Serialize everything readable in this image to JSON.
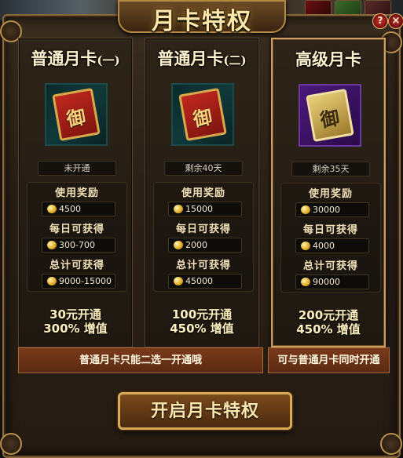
{
  "window": {
    "title": "月卡特权",
    "help_label": "?",
    "close_label": "×"
  },
  "cards": [
    {
      "title": "普通月卡",
      "title_suffix": "(一)",
      "status": "未开通",
      "use_reward_label": "使用奖励",
      "use_reward": "4500",
      "daily_label": "每日可获得",
      "daily": "300-700",
      "total_label": "总计可获得",
      "total": "9000-15000",
      "price": "30元开通",
      "bonus": "300% 增值"
    },
    {
      "title": "普通月卡",
      "title_suffix": "(二)",
      "status": "剩余40天",
      "use_reward_label": "使用奖励",
      "use_reward": "15000",
      "daily_label": "每日可获得",
      "daily": "2000",
      "total_label": "总计可获得",
      "total": "45000",
      "price": "100元开通",
      "bonus": "450% 增值"
    },
    {
      "title": "高级月卡",
      "title_suffix": "",
      "status": "剩余35天",
      "use_reward_label": "使用奖励",
      "use_reward": "30000",
      "daily_label": "每日可获得",
      "daily": "4000",
      "total_label": "总计可获得",
      "total": "90000",
      "price": "200元开通",
      "bonus": "450% 增值"
    }
  ],
  "notes": {
    "normal": "普通月卡只能二选一开通哦",
    "premium": "可与普通月卡同时开通"
  },
  "cta_label": "开启月卡特权",
  "card_art_glyph": "御"
}
